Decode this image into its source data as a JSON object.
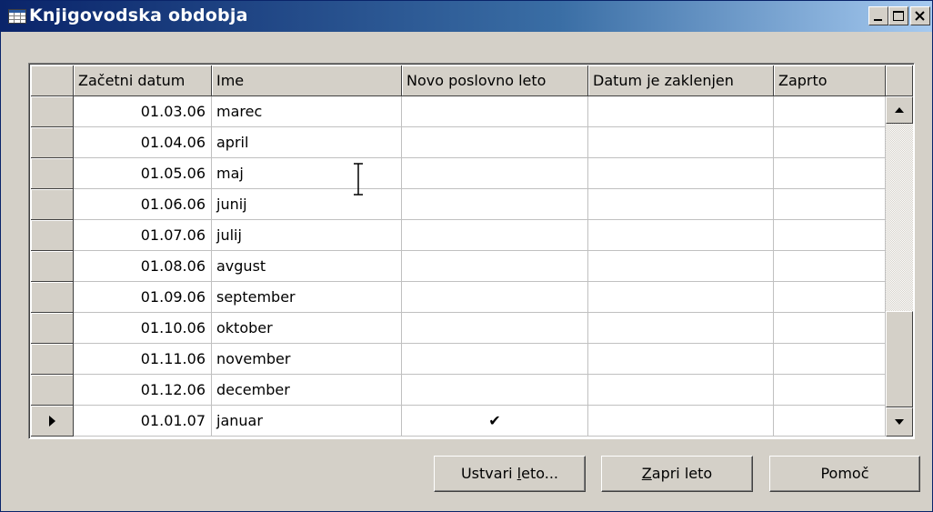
{
  "window": {
    "title": "Knjigovodska obdobja",
    "controls": [
      "minimize",
      "maximize",
      "close"
    ]
  },
  "table": {
    "columns": [
      "Začetni datum",
      "Ime",
      "Novo poslovno leto",
      "Datum je zaklenjen",
      "Zaprto"
    ],
    "rows": [
      {
        "date": "01.03.06",
        "name": "marec",
        "new_year": "",
        "locked": "",
        "closed": ""
      },
      {
        "date": "01.04.06",
        "name": "april",
        "new_year": "",
        "locked": "",
        "closed": ""
      },
      {
        "date": "01.05.06",
        "name": "maj",
        "new_year": "",
        "locked": "",
        "closed": ""
      },
      {
        "date": "01.06.06",
        "name": "junij",
        "new_year": "",
        "locked": "",
        "closed": ""
      },
      {
        "date": "01.07.06",
        "name": "julij",
        "new_year": "",
        "locked": "",
        "closed": ""
      },
      {
        "date": "01.08.06",
        "name": "avgust",
        "new_year": "",
        "locked": "",
        "closed": ""
      },
      {
        "date": "01.09.06",
        "name": "september",
        "new_year": "",
        "locked": "",
        "closed": ""
      },
      {
        "date": "01.10.06",
        "name": "oktober",
        "new_year": "",
        "locked": "",
        "closed": ""
      },
      {
        "date": "01.11.06",
        "name": "november",
        "new_year": "",
        "locked": "",
        "closed": ""
      },
      {
        "date": "01.12.06",
        "name": "december",
        "new_year": "",
        "locked": "",
        "closed": ""
      },
      {
        "date": "01.01.07",
        "name": "januar",
        "new_year": "✔",
        "locked": "",
        "closed": ""
      }
    ],
    "current_row_marker": "row-pointer-icon"
  },
  "buttons": {
    "create_year": {
      "pre": "Ustvari ",
      "key": "l",
      "post": "eto..."
    },
    "close_year": {
      "pre": "",
      "key": "Z",
      "post": "apri leto"
    },
    "help": {
      "pre": "",
      "key": "",
      "post": "Pomoč"
    }
  },
  "colors": {
    "title_start": "#0a246a",
    "title_end": "#a6caf0",
    "face": "#d4d0c8"
  }
}
